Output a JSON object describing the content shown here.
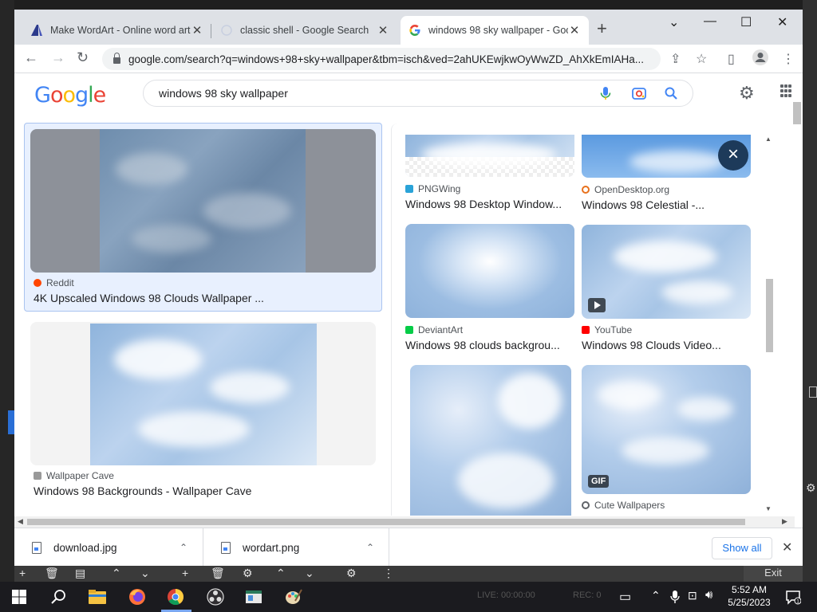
{
  "browser": {
    "tabs": [
      {
        "title": "Make WordArt - Online word art",
        "active": false
      },
      {
        "title": "classic shell - Google Search",
        "active": false
      },
      {
        "title": "windows 98 sky wallpaper - Goo",
        "active": true
      }
    ],
    "url": "google.com/search?q=windows+98+sky+wallpaper&tbm=isch&ved=2ahUKEwjkwOyWwZD_AhXkEmIAHa...",
    "window_controls": {
      "minimize": "—",
      "maximize": "☐",
      "close": "✕"
    }
  },
  "google": {
    "logo": [
      "G",
      "o",
      "o",
      "g",
      "l",
      "e"
    ],
    "query": "windows 98 sky wallpaper"
  },
  "results_left": [
    {
      "source": "Reddit",
      "title": "4K Upscaled Windows 98 Clouds Wallpaper ...",
      "source_color": "#ff4500"
    },
    {
      "source": "Wallpaper Cave",
      "title": "Windows 98 Backgrounds - Wallpaper Cave",
      "source_color": "#777777"
    }
  ],
  "results_panel": [
    {
      "source": "PNGWing",
      "title": "Windows 98 Desktop Window...",
      "source_color": "#2aa3d8"
    },
    {
      "source": "OpenDesktop.org",
      "title": "Windows 98 Celestial -...",
      "source_color": "#e8711c"
    },
    {
      "source": "DeviantArt",
      "title": "Windows 98 clouds backgrou...",
      "source_color": "#05cc47"
    },
    {
      "source": "YouTube",
      "title": "Windows 98 Clouds Video...",
      "source_color": "#ff0000"
    },
    {
      "source": "Cute Wallpapers",
      "title": "",
      "source_color": "#5f6368"
    }
  ],
  "badges": {
    "gif": "GIF"
  },
  "downloads": {
    "items": [
      "download.jpg",
      "wordart.png"
    ],
    "show_all": "Show all"
  },
  "obs": {
    "exit": "Exit",
    "live": "LIVE: 00:00:00",
    "rec": "REC: 0"
  },
  "taskbar": {
    "time": "5:52 AM",
    "date": "5/25/2023"
  }
}
